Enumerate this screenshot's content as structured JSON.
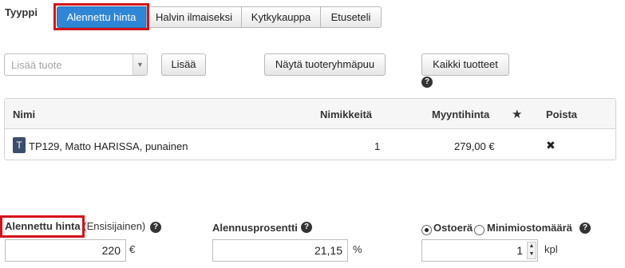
{
  "type_section": {
    "label": "Tyyppi",
    "tabs": [
      {
        "label": "Alennettu hinta",
        "active": true
      },
      {
        "label": "Halvin ilmaiseksi",
        "active": false
      },
      {
        "label": "Kytkykauppa",
        "active": false
      },
      {
        "label": "Etuseteli",
        "active": false
      }
    ]
  },
  "product_picker": {
    "placeholder": "Lisää tuote",
    "add_label": "Lisää",
    "show_groups_label": "Näytä tuoteryhmäpuu",
    "all_products_label": "Kaikki tuotteet",
    "help_icon": "question-circle-icon"
  },
  "table": {
    "columns": [
      "Nimi",
      "Nimikkeitä",
      "Myyntihinta",
      "star-icon",
      "Poista"
    ],
    "rows": [
      {
        "type_badge": "T",
        "name": "TP129, Matto HARISSA, punainen",
        "count": "1",
        "price": "279,00 €",
        "delete_icon": "x-icon"
      }
    ]
  },
  "discount_price": {
    "label": "Alennettu hinta",
    "suffix": "(Ensisijainen)",
    "value": "220",
    "unit": "€"
  },
  "discount_percent": {
    "label": "Alennusprosentti",
    "value": "21,15",
    "unit": "%"
  },
  "quantity": {
    "option1": "Ostoerä",
    "option2": "Minimiostomäärä",
    "selected": "Ostoerä",
    "value": "1",
    "unit": "kpl"
  },
  "colors": {
    "accent": "#2f86d6",
    "highlight_border": "#d3141b"
  }
}
